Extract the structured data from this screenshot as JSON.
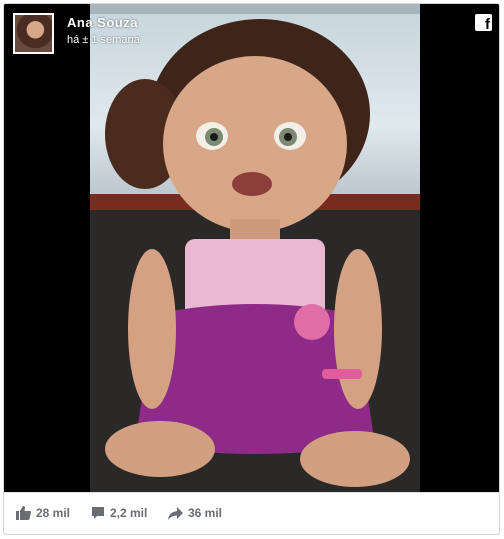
{
  "post": {
    "author": "Ana  Souza",
    "time": "há ± 1 semana",
    "platform_icon": "facebook-icon"
  },
  "stats": {
    "likes": "28 mil",
    "comments": "2,2 mil",
    "shares": "36 mil"
  },
  "colors": {
    "stat_text": "#6a6d73",
    "border": "#d4d6da"
  }
}
